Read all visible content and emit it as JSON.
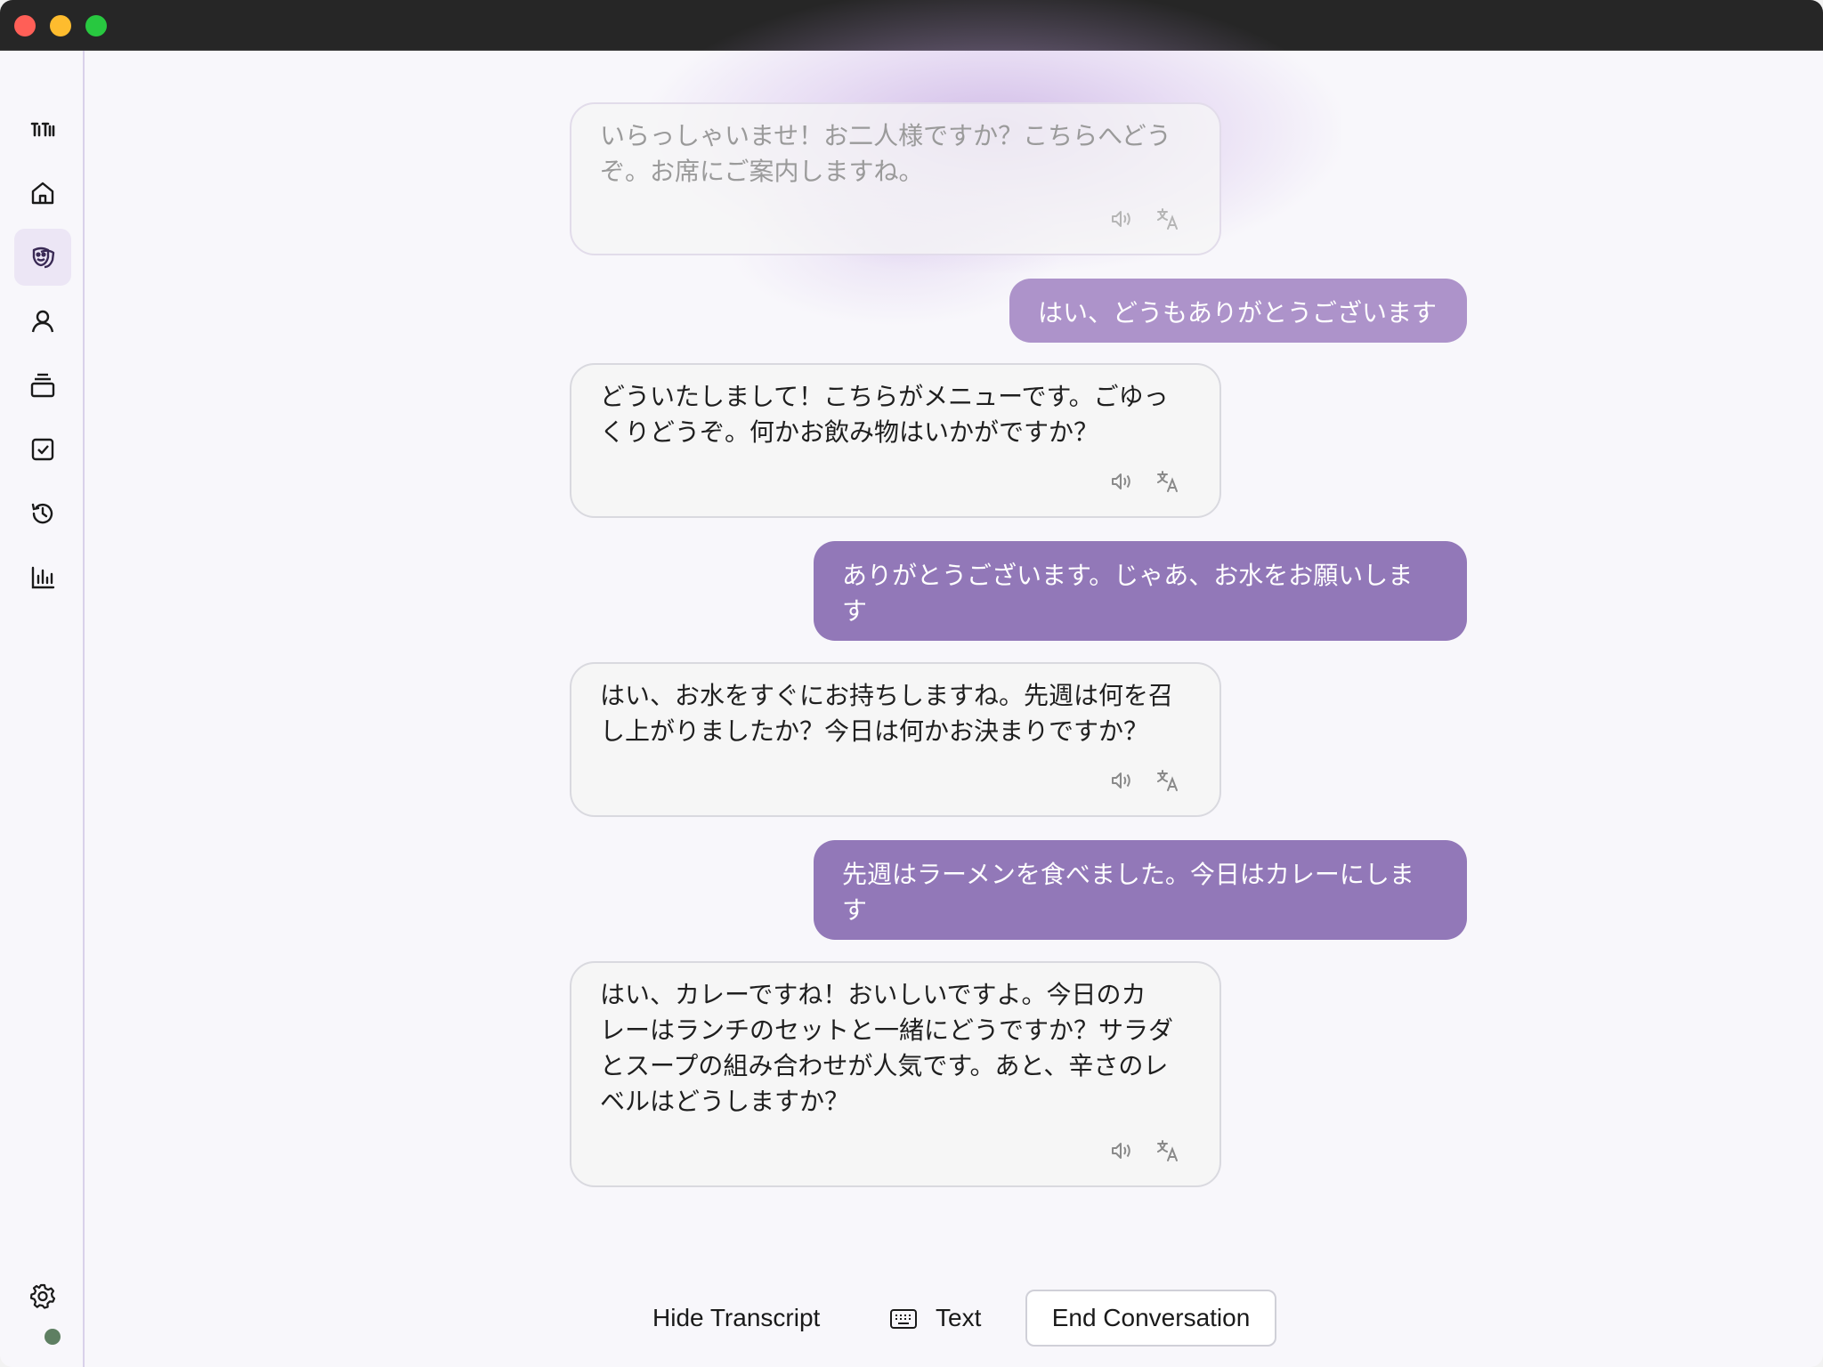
{
  "window": {
    "traffic_lights": [
      "close",
      "minimize",
      "maximize"
    ]
  },
  "sidebar": {
    "items": [
      {
        "name": "logo-icon",
        "active": false
      },
      {
        "name": "home-icon",
        "active": false
      },
      {
        "name": "roleplay-mask-icon",
        "active": true
      },
      {
        "name": "person-icon",
        "active": false
      },
      {
        "name": "stack-icon",
        "active": false
      },
      {
        "name": "checkbox-icon",
        "active": false
      },
      {
        "name": "history-icon",
        "active": false
      },
      {
        "name": "chart-icon",
        "active": false
      }
    ],
    "settings_icon": "gear-icon",
    "status_dot_color": "#5e7f62"
  },
  "conversation": {
    "messages": [
      {
        "role": "ai",
        "lines": [
          "いらっしゃいませ！お二人様ですか？こちらへどう",
          "ぞ。お席にご案内しますね。"
        ],
        "faded": true
      },
      {
        "role": "user",
        "lines": [
          "はい、どうもありがとうございます"
        ]
      },
      {
        "role": "ai",
        "lines": [
          "どういたしまして！こちらがメニューです。ごゆっ",
          "くりどうぞ。何かお飲み物はいかがですか？"
        ]
      },
      {
        "role": "user",
        "lines": [
          "ありがとうございます。じゃあ、お水をお願いしま",
          "す"
        ]
      },
      {
        "role": "ai",
        "lines": [
          "はい、お水をすぐにお持ちしますね。先週は何を召",
          "し上がりましたか？今日は何かお決まりですか？"
        ]
      },
      {
        "role": "user",
        "lines": [
          "先週はラーメンを食べました。今日はカレーにしま",
          "す"
        ]
      },
      {
        "role": "ai",
        "lines": [
          "はい、カレーですね！おいしいですよ。今日のカ",
          "レーはランチのセットと一緒にどうですか？サラダ",
          "とスープの組み合わせが人気です。あと、辛さのレ",
          "ベルはどうしますか？"
        ]
      }
    ],
    "ai_actions": [
      "speaker-icon",
      "translate-icon"
    ]
  },
  "controls": {
    "hide_transcript": "Hide Transcript",
    "text": "Text",
    "end_conversation": "End Conversation"
  },
  "colors": {
    "accent": "#9278b8",
    "accent_light": "#ad93ca",
    "glow": "#b08ad6"
  }
}
